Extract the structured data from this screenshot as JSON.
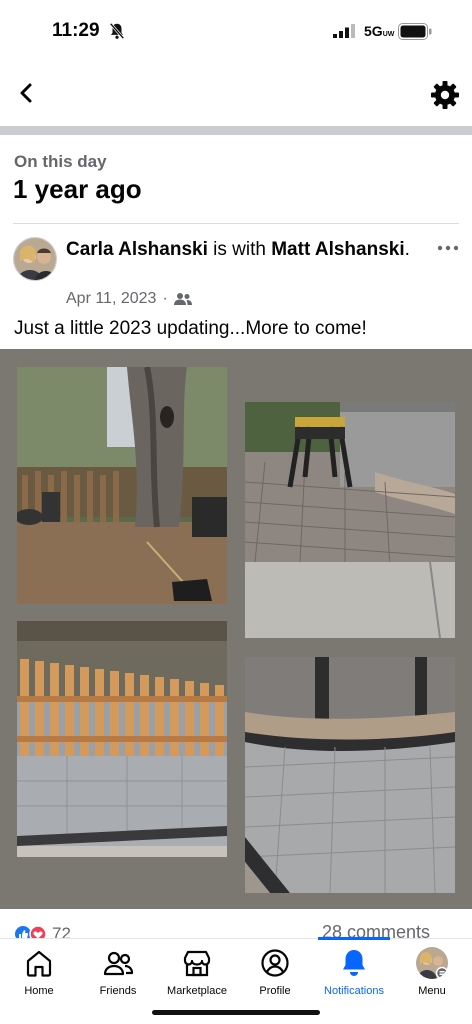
{
  "status_bar": {
    "time": "11:29",
    "network": "5G",
    "network_sub": "UW"
  },
  "header": {
    "back_icon": "chevron-left-icon",
    "settings_icon": "gear-icon"
  },
  "memory": {
    "subtitle": "On this day",
    "title": "1 year ago"
  },
  "post": {
    "author": "Carla Alshanski",
    "with_text": "is with",
    "tagged": "Matt Alshanski",
    "date": "Apr 11, 2023",
    "separator": "·",
    "audience_icon": "friends-icon",
    "text": "Just a little 2023 updating...More to come!",
    "reaction_count": "72",
    "comments": "28 comments"
  },
  "nav": {
    "items": [
      {
        "label": "Home",
        "icon": "home-icon"
      },
      {
        "label": "Friends",
        "icon": "friends-icon"
      },
      {
        "label": "Marketplace",
        "icon": "marketplace-icon"
      },
      {
        "label": "Profile",
        "icon": "profile-icon"
      },
      {
        "label": "Notifications",
        "icon": "bell-icon",
        "active": true
      },
      {
        "label": "Menu",
        "icon": "menu-avatar"
      }
    ]
  },
  "colors": {
    "accent": "#0866ff",
    "collage_bg": "#7b7872",
    "divider": "#c9ccd1"
  }
}
